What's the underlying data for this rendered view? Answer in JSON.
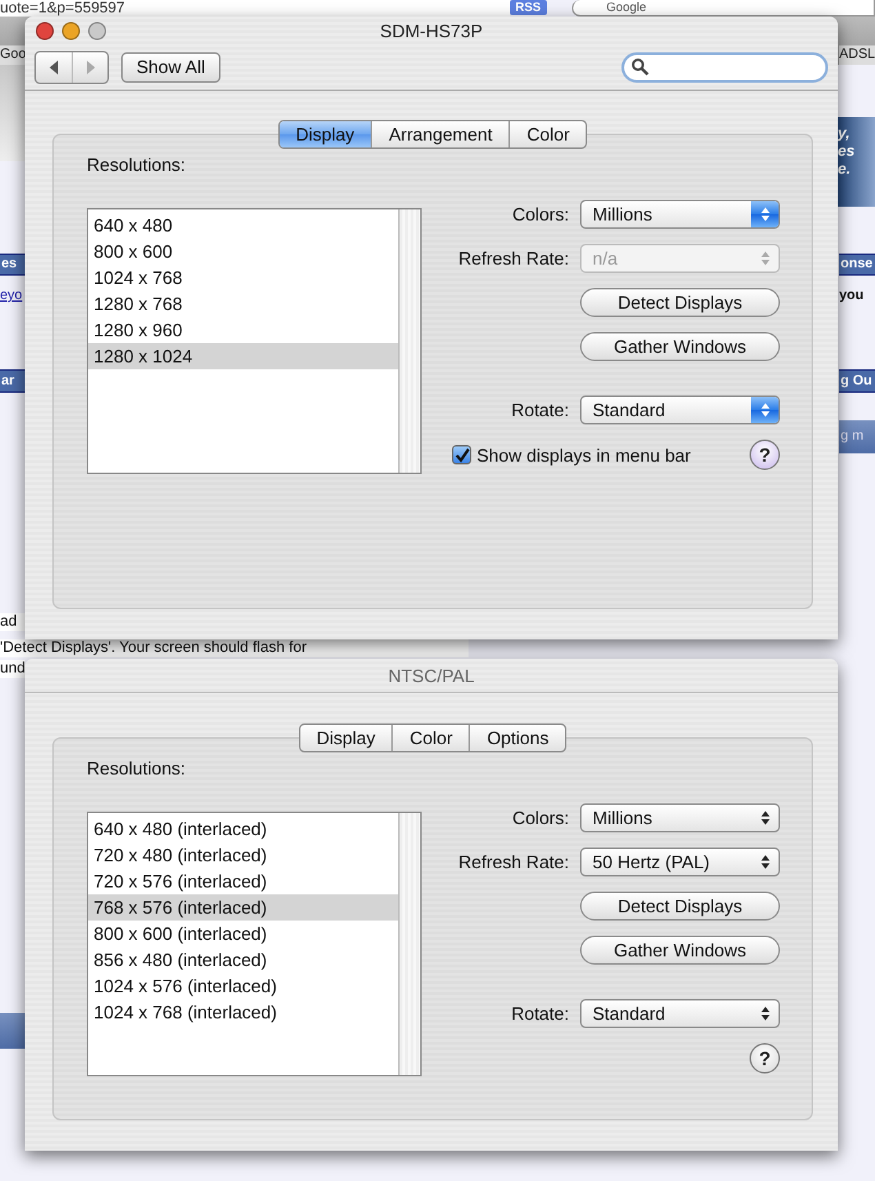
{
  "browser": {
    "url": "uote=1&p=559597",
    "rss": "RSS",
    "search_placeholder": "Google",
    "bookmarks": [
      "Goo",
      "ADSL"
    ],
    "banner_lines": [
      "y,",
      "es",
      "e."
    ],
    "fragments": [
      {
        "kind": "header",
        "text": "es"
      },
      {
        "kind": "link",
        "text": "eyo"
      },
      {
        "kind": "header",
        "text": "ar"
      },
      {
        "kind": "text",
        "text": "ad"
      },
      {
        "kind": "text",
        "text": "'Detect Displays'. Your screen should flash for"
      },
      {
        "kind": "text",
        "text": "und"
      },
      {
        "kind": "header",
        "text": "onse"
      },
      {
        "kind": "bold",
        "text": "you"
      },
      {
        "kind": "header",
        "text": "g Ou"
      },
      {
        "kind": "band",
        "text": "g m"
      }
    ]
  },
  "windows": [
    {
      "title": "SDM-HS73P",
      "active": true,
      "window_buttons": [
        {
          "color": "#e0443e"
        },
        {
          "color": "#eba426"
        },
        {
          "color": "#c9c9c9"
        }
      ],
      "toolbar": {
        "nav_buttons": [
          {
            "kind": "back",
            "disabled": false
          },
          {
            "kind": "forward",
            "disabled": true
          }
        ],
        "show_all": "Show All"
      },
      "tabs": [
        {
          "label": "Display",
          "selected": true
        },
        {
          "label": "Arrangement",
          "selected": false
        },
        {
          "label": "Color",
          "selected": false
        }
      ],
      "resolutions_label": "Resolutions:",
      "resolutions": [
        {
          "label": "640 x 480",
          "selected": false
        },
        {
          "label": "800 x 600",
          "selected": false
        },
        {
          "label": "1024 x 768",
          "selected": false
        },
        {
          "label": "1280 x 768",
          "selected": false
        },
        {
          "label": "1280 x 960",
          "selected": false
        },
        {
          "label": "1280 x 1024",
          "selected": true
        }
      ],
      "colors": {
        "label": "Colors:",
        "value": "Millions",
        "disabled": false
      },
      "refresh_rate": {
        "label": "Refresh Rate:",
        "value": "n/a",
        "disabled": true
      },
      "buttons": [
        "Detect Displays",
        "Gather Windows"
      ],
      "rotate": {
        "label": "Rotate:",
        "value": "Standard",
        "disabled": false
      },
      "menu_bar_checkbox": {
        "label": "Show displays in menu bar",
        "checked": true
      },
      "help": "?"
    },
    {
      "title": "NTSC/PAL",
      "active": false,
      "tabs": [
        {
          "label": "Display",
          "selected": false
        },
        {
          "label": "Color",
          "selected": false
        },
        {
          "label": "Options",
          "selected": false
        }
      ],
      "resolutions_label": "Resolutions:",
      "resolutions": [
        {
          "label": "640 x 480 (interlaced)",
          "selected": false
        },
        {
          "label": "720 x 480 (interlaced)",
          "selected": false
        },
        {
          "label": "720 x 576 (interlaced)",
          "selected": false
        },
        {
          "label": "768 x 576 (interlaced)",
          "selected": true
        },
        {
          "label": "800 x 600 (interlaced)",
          "selected": false
        },
        {
          "label": "856 x 480 (interlaced)",
          "selected": false
        },
        {
          "label": "1024 x 576 (interlaced)",
          "selected": false
        },
        {
          "label": "1024 x 768 (interlaced)",
          "selected": false
        }
      ],
      "colors": {
        "label": "Colors:",
        "value": "Millions",
        "disabled": false
      },
      "refresh_rate": {
        "label": "Refresh Rate:",
        "value": "50 Hertz (PAL)",
        "disabled": false
      },
      "buttons": [
        "Detect Displays",
        "Gather Windows"
      ],
      "rotate": {
        "label": "Rotate:",
        "value": "Standard",
        "disabled": false
      },
      "help": "?"
    }
  ]
}
